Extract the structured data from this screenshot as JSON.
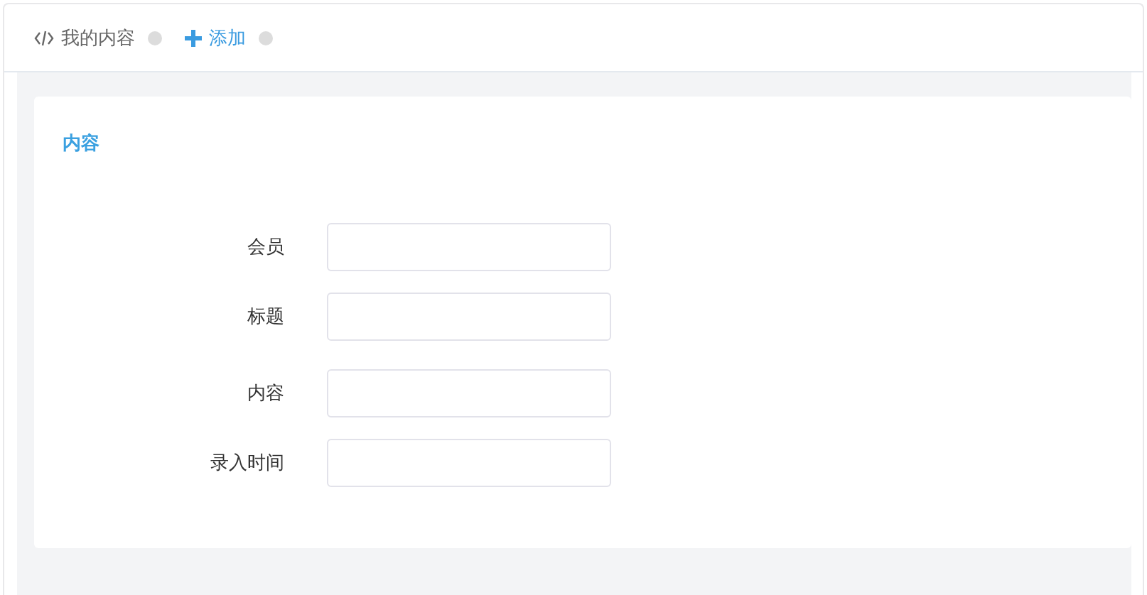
{
  "tabs": [
    {
      "label": "我的内容",
      "kind": "code",
      "selected": false
    },
    {
      "label": "添加",
      "kind": "add",
      "selected": true
    }
  ],
  "card": {
    "title": "内容"
  },
  "fields": [
    {
      "label": "会员"
    },
    {
      "label": "标题"
    },
    {
      "label": "内容"
    },
    {
      "label": "录入时间"
    }
  ]
}
